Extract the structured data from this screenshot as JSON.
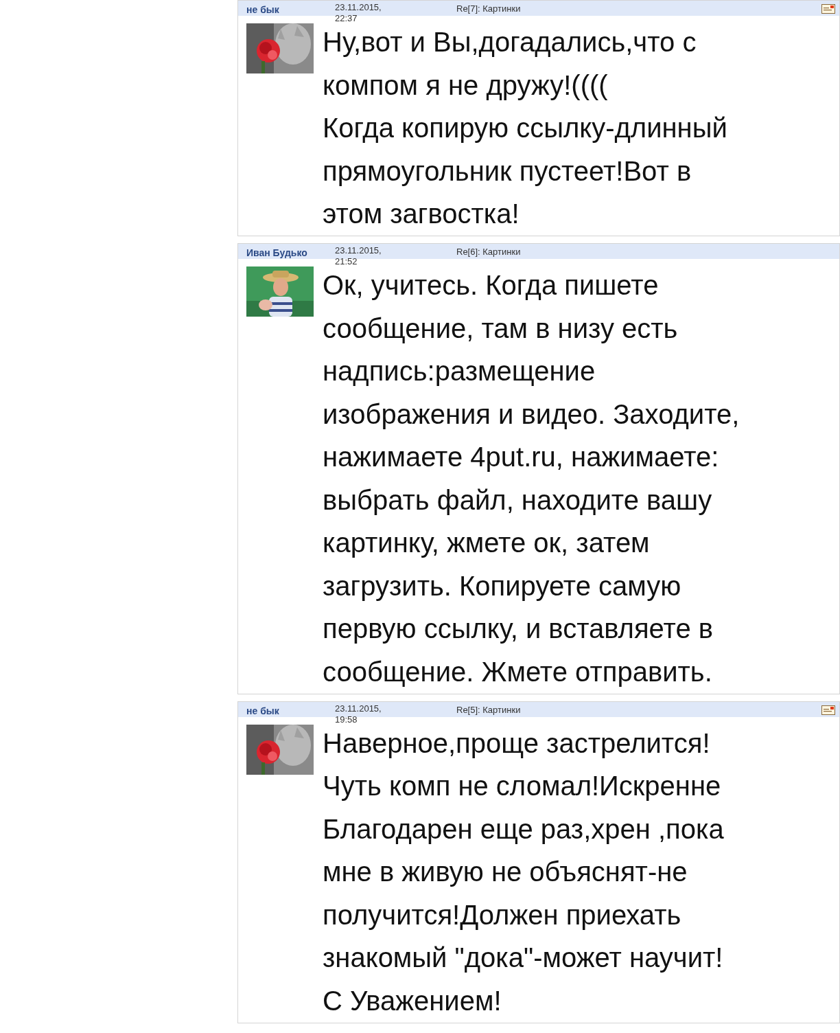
{
  "posts": [
    {
      "author": "не бык",
      "date": "23.11.2015, 22:37",
      "subject": "Re[7]: Картинки",
      "reply_icon": true,
      "avatar": {
        "kind": "rose"
      },
      "lines": [
        "Ну,вот и Вы,догадались,что с",
        "компом я не дружу!((((",
        "Когда копирую ссылку-длинный",
        "прямоугольник пустеет!Вот в",
        "этом загвостка!"
      ]
    },
    {
      "author": "Иван Будько",
      "date": "23.11.2015, 21:52",
      "subject": "Re[6]: Картинки",
      "reply_icon": false,
      "avatar": {
        "kind": "man"
      },
      "lines": [
        "Ок, учитесь. Когда пишете",
        "сообщение, там в низу есть",
        "надпись:размещение",
        "изображения и видео. Заходите,",
        "нажимаете 4put.ru, нажимаете:",
        "выбрать файл, находите вашу",
        "картинку, жмете ок, затем",
        "загрузить. Копируете самую",
        "первую ссылку, и вставляете в",
        "сообщение. Жмете отправить."
      ]
    },
    {
      "author": "не бык",
      "date": "23.11.2015, 19:58",
      "subject": "Re[5]: Картинки",
      "reply_icon": true,
      "avatar": {
        "kind": "rose"
      },
      "lines": [
        "Наверное,проще застрелится!",
        "Чуть комп не сломал!Искренне",
        "Благодарен еще раз,хрен ,пока",
        "мне в живую не объяснят-не",
        "получится!Должен приехать",
        "знакомый \"дока\"-может научит!",
        "С Уважением!"
      ]
    }
  ]
}
